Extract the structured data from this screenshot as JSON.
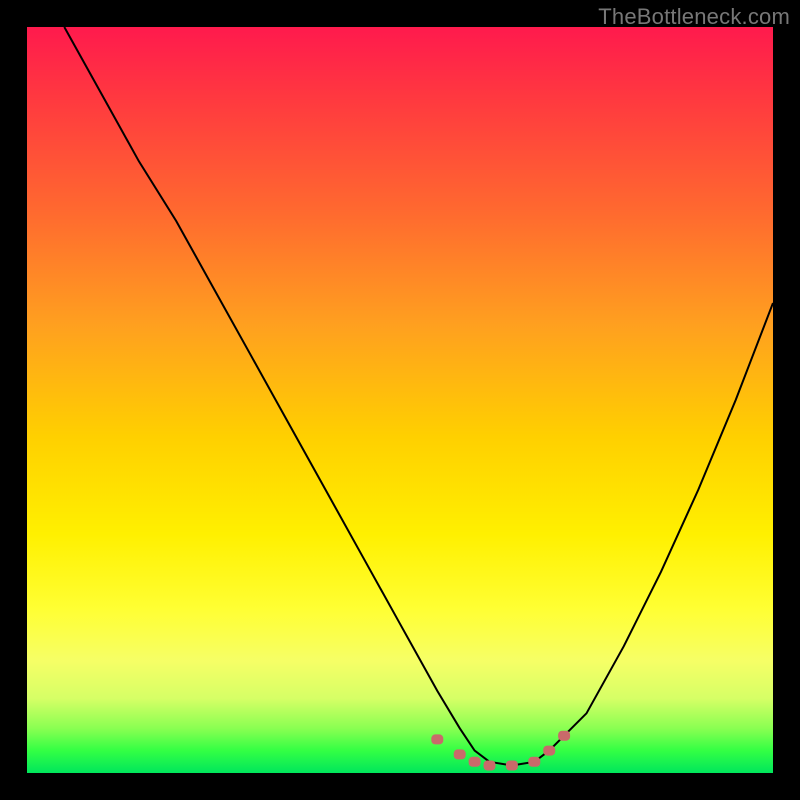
{
  "watermark": "TheBottleneck.com",
  "chart_data": {
    "type": "line",
    "title": "",
    "xlabel": "",
    "ylabel": "",
    "xlim": [
      0,
      100
    ],
    "ylim": [
      0,
      100
    ],
    "series": [
      {
        "name": "curve",
        "x": [
          5,
          10,
          15,
          20,
          25,
          30,
          35,
          40,
          45,
          50,
          55,
          58,
          60,
          62,
          65,
          68,
          70,
          75,
          80,
          85,
          90,
          95,
          100
        ],
        "y": [
          100,
          91,
          82,
          74,
          65,
          56,
          47,
          38,
          29,
          20,
          11,
          6,
          3,
          1.5,
          1,
          1.5,
          3,
          8,
          17,
          27,
          38,
          50,
          63
        ]
      }
    ],
    "highlight": {
      "name": "bottom-band",
      "x": [
        55,
        58,
        60,
        62,
        65,
        68,
        70,
        72
      ],
      "y": [
        4.5,
        2.5,
        1.5,
        1,
        1,
        1.5,
        3,
        5
      ]
    },
    "gradient_stops": [
      {
        "pos": 0,
        "color": "#ff1a4d"
      },
      {
        "pos": 55,
        "color": "#ffd000"
      },
      {
        "pos": 85,
        "color": "#f6ff66"
      },
      {
        "pos": 100,
        "color": "#00e65c"
      }
    ]
  }
}
